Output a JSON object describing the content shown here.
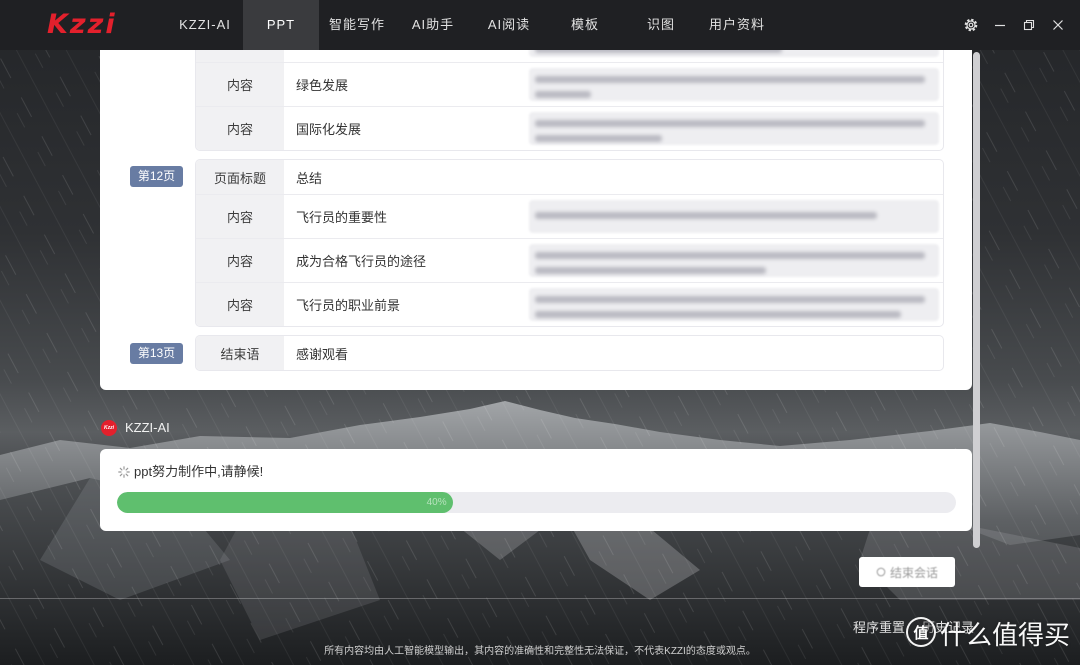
{
  "theme": {
    "brand": "#e3202c",
    "badge": "#687ca3",
    "progress_fill": "#5fbf6e"
  },
  "app": {
    "logo_text": "Kzzi"
  },
  "nav": {
    "active_index": 1,
    "tabs": [
      {
        "label": "KZZI-AI"
      },
      {
        "label": "PPT"
      },
      {
        "label": "智能写作"
      },
      {
        "label": "AI助手"
      },
      {
        "label": "AI阅读"
      },
      {
        "label": "模板"
      },
      {
        "label": "识图"
      },
      {
        "label": "用户资料"
      }
    ]
  },
  "window_controls": {
    "icons": [
      "gear-icon",
      "minimize-icon",
      "restore-icon",
      "close-icon"
    ]
  },
  "outline": {
    "pages": [
      {
        "rows": [
          {
            "label": "内容",
            "value": "绿色发展"
          },
          {
            "label": "内容",
            "value": "国际化发展"
          }
        ]
      },
      {
        "badge": "第12页",
        "rows": [
          {
            "label": "页面标题",
            "value": "总结"
          },
          {
            "label": "内容",
            "value": "飞行员的重要性"
          },
          {
            "label": "内容",
            "value": "成为合格飞行员的途径"
          },
          {
            "label": "内容",
            "value": "飞行员的职业前景"
          }
        ]
      },
      {
        "badge": "第13页",
        "rows": [
          {
            "label": "结束语",
            "value": "感谢观看"
          }
        ]
      }
    ]
  },
  "assistant": {
    "name": "KZZI-AI",
    "avatar_text": "Kzzi"
  },
  "progress": {
    "icon": "loading-icon",
    "message": "ppt努力制作中,请静候!",
    "percent": 40,
    "percent_label": "40%"
  },
  "actions": {
    "end_session": "结束会话",
    "reset": "程序重置",
    "history": "历史记录"
  },
  "footer": {
    "disclaimer": "所有内容均由人工智能模型输出，其内容的准确性和完整性无法保证，不代表KZZI的态度或观点。"
  },
  "watermark": {
    "icon_char": "值",
    "text": "什么值得买"
  }
}
